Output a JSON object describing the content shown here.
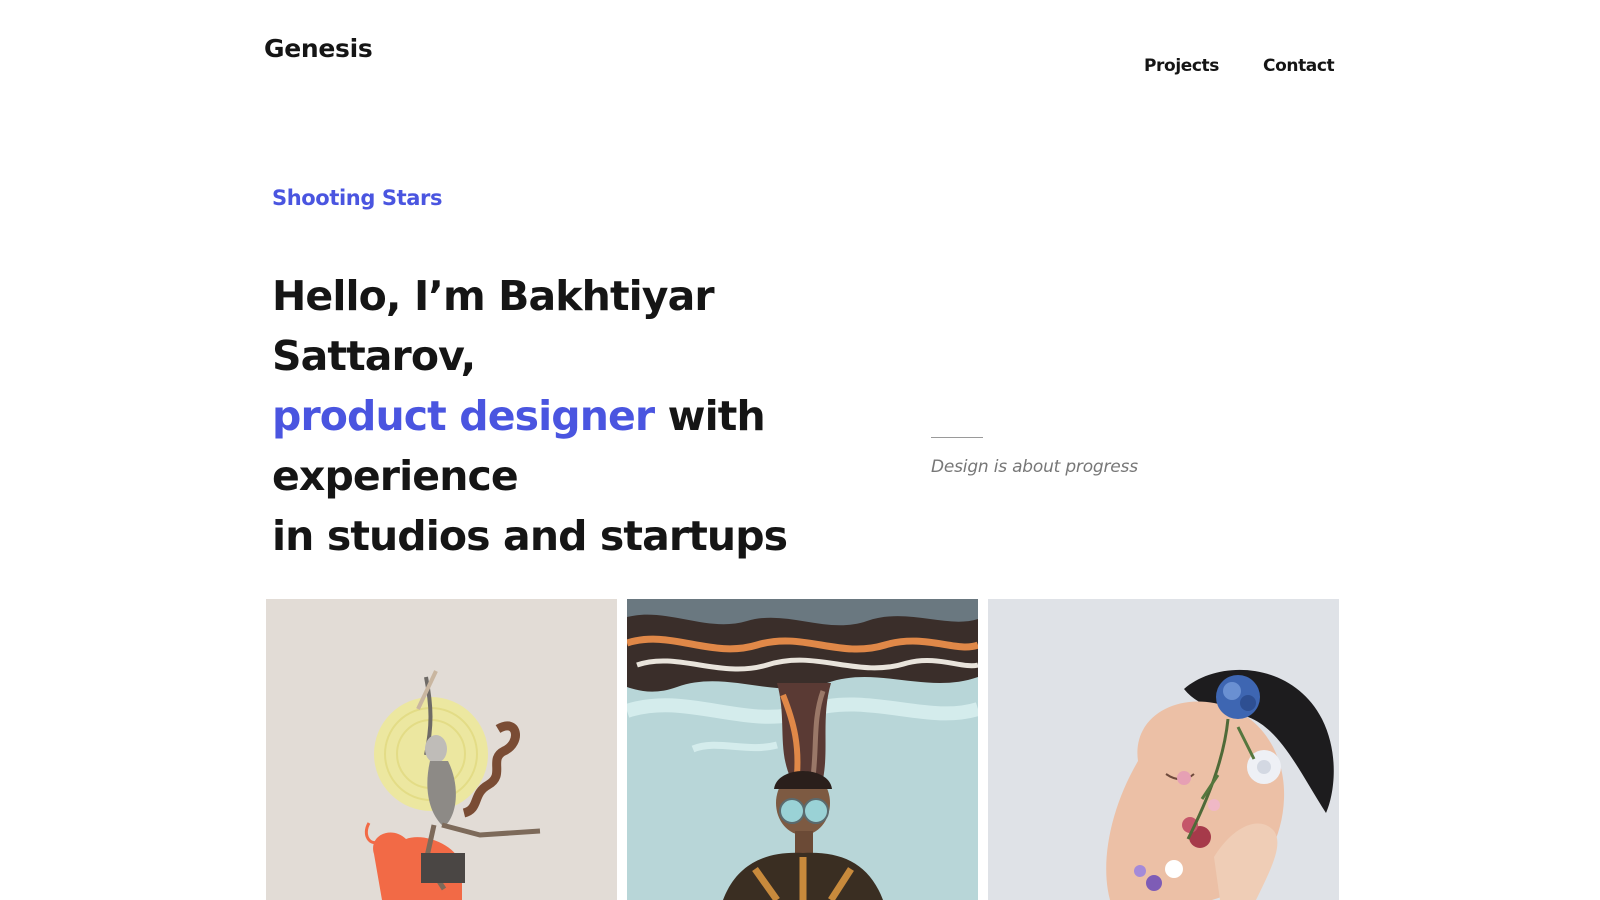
{
  "header": {
    "brand": "Genesis",
    "nav": [
      {
        "label": "Projects"
      },
      {
        "label": "Contact"
      }
    ]
  },
  "hero": {
    "eyebrow": "Shooting Stars",
    "line1": "Hello, I’m Bakhtiyar Sattarov,",
    "accent": "product designer",
    "rest_line2": " with experience",
    "line3": "in studios and startups"
  },
  "aside": {
    "quote": "Design is about progress"
  },
  "colors": {
    "accent": "#4a55e0",
    "text": "#151515",
    "muted": "#777777"
  },
  "gallery": [
    {
      "icon": "dancer-collage-image"
    },
    {
      "icon": "man-smoke-waves-image"
    },
    {
      "icon": "man-flowers-face-image"
    }
  ]
}
